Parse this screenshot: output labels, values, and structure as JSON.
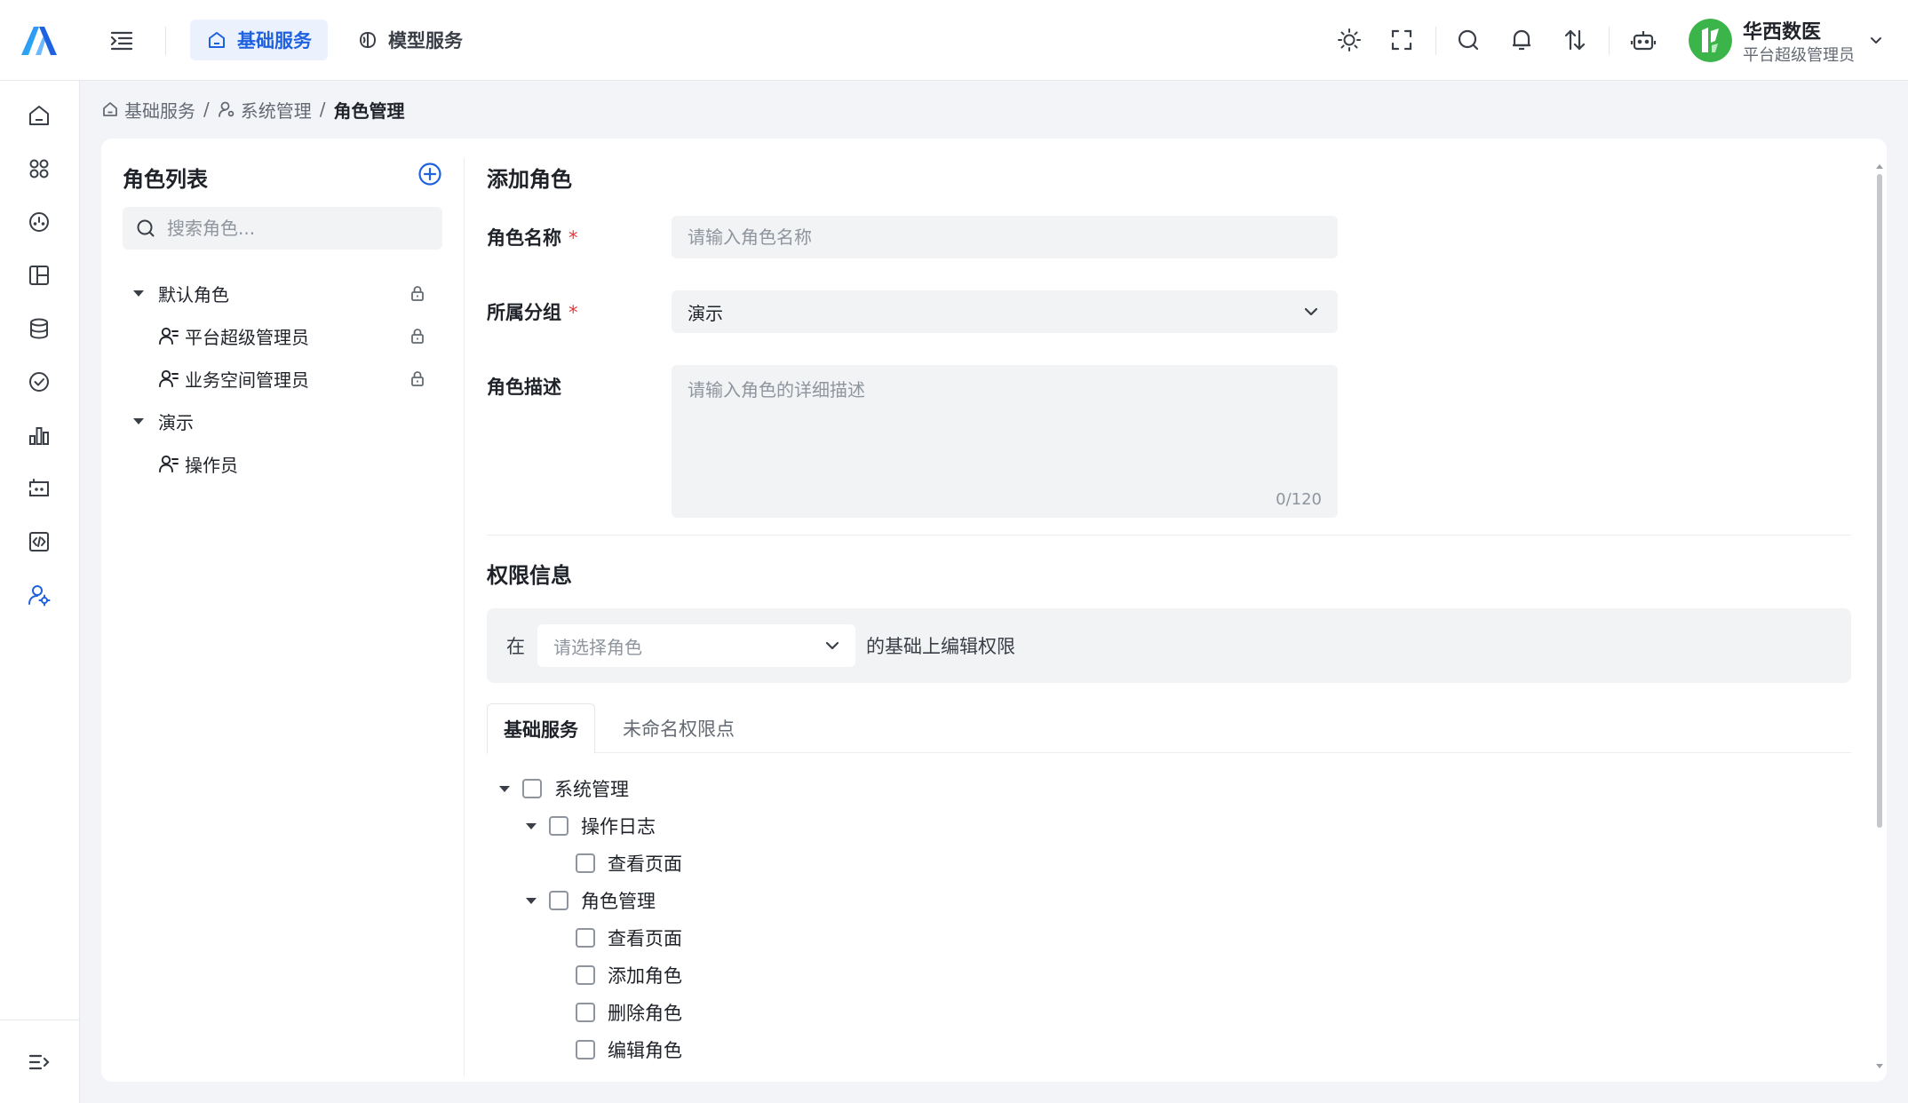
{
  "header": {
    "nav": [
      {
        "label": "基础服务",
        "icon": "home-icon",
        "active": true
      },
      {
        "label": "模型服务",
        "icon": "brain-icon",
        "active": false
      }
    ],
    "icons": [
      "sun-icon",
      "fullscreen-icon",
      "search-icon",
      "bell-icon",
      "sort-icon",
      "robot-icon"
    ],
    "user": {
      "name": "华西数医",
      "role": "平台超级管理员"
    },
    "accent": "#1f62e0",
    "avatar_color": "#3bb54a"
  },
  "rail": {
    "items": [
      "home-icon",
      "apps-icon",
      "dashboard-icon",
      "layout-icon",
      "database-icon",
      "check-circle-icon",
      "bar-chart-icon",
      "ticket-icon",
      "code-icon",
      "user-settings-icon"
    ],
    "active": "user-settings-icon",
    "bottom": "expand-menu-icon"
  },
  "breadcrumb": [
    {
      "label": "基础服务",
      "icon": "home-icon"
    },
    {
      "label": "系统管理",
      "icon": "user-settings-icon"
    },
    {
      "label": "角色管理"
    }
  ],
  "breadcrumb_sep": "/",
  "role_list": {
    "title": "角色列表",
    "search_placeholder": "搜索角色...",
    "groups": [
      {
        "label": "默认角色",
        "locked": true,
        "roles": [
          {
            "label": "平台超级管理员",
            "locked": true
          },
          {
            "label": "业务空间管理员",
            "locked": true
          }
        ]
      },
      {
        "label": "演示",
        "locked": false,
        "roles": [
          {
            "label": "操作员",
            "locked": false
          }
        ]
      }
    ]
  },
  "form": {
    "title": "添加角色",
    "name_label": "角色名称",
    "name_placeholder": "请输入角色名称",
    "group_label": "所属分组",
    "group_value": "演示",
    "desc_label": "角色描述",
    "desc_placeholder": "请输入角色的详细描述",
    "desc_count": "0/120",
    "required_mark": "*"
  },
  "permissions": {
    "title": "权限信息",
    "prefix": "在",
    "select_placeholder": "请选择角色",
    "suffix": "的基础上编辑权限",
    "tabs": [
      {
        "label": "基础服务",
        "active": true
      },
      {
        "label": "未命名权限点",
        "active": false
      }
    ],
    "tree": [
      {
        "label": "系统管理",
        "level": 0,
        "expandable": true
      },
      {
        "label": "操作日志",
        "level": 1,
        "expandable": true
      },
      {
        "label": "查看页面",
        "level": 2,
        "expandable": false
      },
      {
        "label": "角色管理",
        "level": 1,
        "expandable": true
      },
      {
        "label": "查看页面",
        "level": 2,
        "expandable": false
      },
      {
        "label": "添加角色",
        "level": 2,
        "expandable": false
      },
      {
        "label": "删除角色",
        "level": 2,
        "expandable": false
      },
      {
        "label": "编辑角色",
        "level": 2,
        "expandable": false
      }
    ]
  }
}
